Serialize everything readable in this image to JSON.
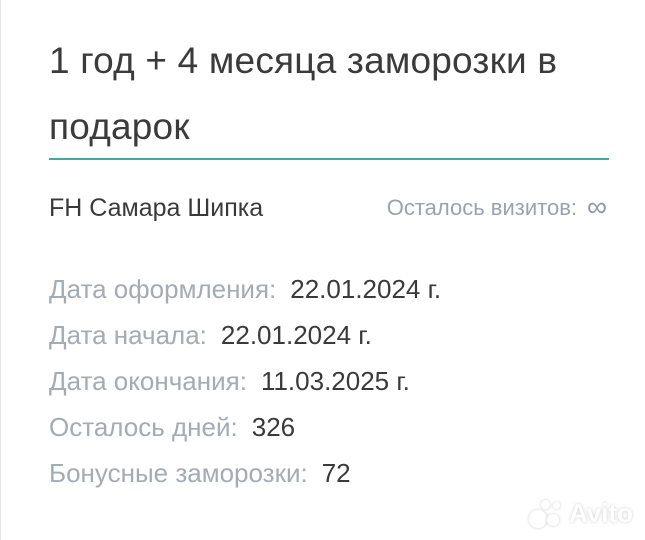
{
  "subscription": {
    "title": "1 год + 4 месяца заморозки в подарок",
    "club": "FH Самара Шипка",
    "visits_label": "Осталось визитов:",
    "visits_value": "∞"
  },
  "details": [
    {
      "label": "Дата оформления:",
      "value": "22.01.2024 г."
    },
    {
      "label": "Дата начала:",
      "value": "22.01.2024 г."
    },
    {
      "label": "Дата окончания:",
      "value": "11.03.2025 г."
    },
    {
      "label": "Осталось дней:",
      "value": "326"
    },
    {
      "label": "Бонусные заморозки:",
      "value": "72"
    }
  ],
  "watermark": {
    "text": "Avito"
  },
  "colors": {
    "accent": "#4aa3a5",
    "text": "#3a3a3a",
    "muted": "#a3abb3"
  }
}
